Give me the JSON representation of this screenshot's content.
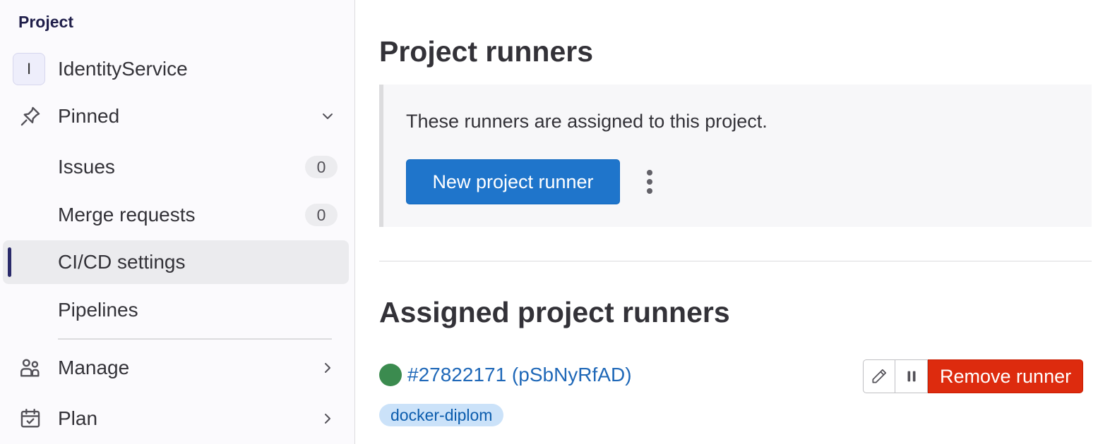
{
  "sidebar": {
    "heading": "Project",
    "project": {
      "avatar_letter": "I",
      "name": "IdentityService"
    },
    "pinned": {
      "label": "Pinned",
      "icon": "pin-icon",
      "chevron": "chevron-down-icon"
    },
    "pinned_items": [
      {
        "label": "Issues",
        "count": "0"
      },
      {
        "label": "Merge requests",
        "count": "0"
      },
      {
        "label": "CI/CD settings",
        "active": true
      },
      {
        "label": "Pipelines"
      }
    ],
    "sections": [
      {
        "label": "Manage",
        "icon": "users-icon",
        "chevron": "chevron-right-icon"
      },
      {
        "label": "Plan",
        "icon": "calendar-icon",
        "chevron": "chevron-right-icon"
      }
    ]
  },
  "main": {
    "title": "Project runners",
    "info_text": "These runners are assigned to this project.",
    "new_runner_label": "New project runner",
    "more_actions_icon": "kebab-vertical-icon",
    "section_title": "Assigned project runners",
    "runner": {
      "status": "online",
      "status_color": "#3b8b4f",
      "link_text": "#27822171 (pSbNyRfAD)",
      "tag": "docker-diplom",
      "edit_icon": "pencil-icon",
      "pause_icon": "pause-icon",
      "remove_label": "Remove runner"
    }
  },
  "colors": {
    "primary": "#1f75cb",
    "danger": "#dd2b0e",
    "link": "#1f68b8",
    "active_indicator": "#2a2a6a"
  }
}
